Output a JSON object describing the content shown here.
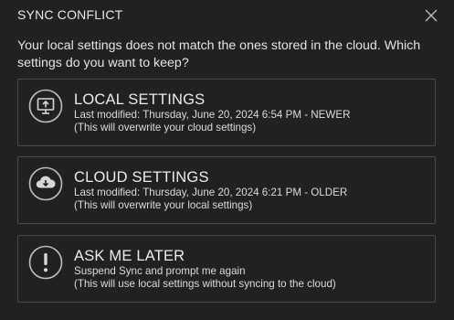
{
  "dialog": {
    "title": "SYNC CONFLICT",
    "close_icon": "close-icon",
    "message": "Your local settings does not match the ones stored in the cloud. Which settings do you want to keep?",
    "options": [
      {
        "icon": "monitor-upload-icon",
        "heading": "LOCAL SETTINGS",
        "line1": "Last modified: Thursday, June 20, 2024 6:54 PM - NEWER",
        "line2": "(This will overwrite your cloud settings)"
      },
      {
        "icon": "cloud-download-icon",
        "heading": "CLOUD SETTINGS",
        "line1": "Last modified: Thursday, June 20, 2024 6:21 PM - OLDER",
        "line2": "(This will overwrite your local settings)"
      },
      {
        "icon": "exclamation-icon",
        "heading": "ASK ME LATER",
        "line1": "Suspend Sync and prompt me again",
        "line2": "(This will use local settings without syncing to the cloud)"
      }
    ]
  }
}
